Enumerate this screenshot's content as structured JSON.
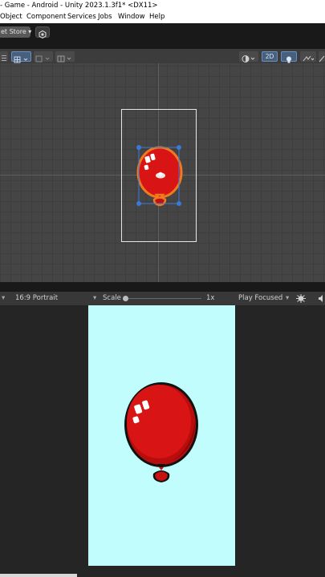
{
  "window": {
    "title": "- Game - Android - Unity 2023.1.3f1* <DX11>"
  },
  "menu": {
    "items": [
      "Object",
      "Component",
      "Services",
      "Jobs",
      "Window",
      "Help"
    ]
  },
  "toolbar": {
    "asset_store_label": "et Store ▾"
  },
  "scene_toolbar": {
    "mode_2d_label": "2D"
  },
  "game_toolbar": {
    "aspect_label": "16:9 Portrait",
    "scale_label": "Scale",
    "scale_value": "1x",
    "play_mode_label": "Play Focused"
  },
  "colors": {
    "balloon": "#d81414",
    "game_background": "#c1fdfd",
    "selection_outline": "#f07a1e",
    "handle_blue": "#3a79d8"
  }
}
